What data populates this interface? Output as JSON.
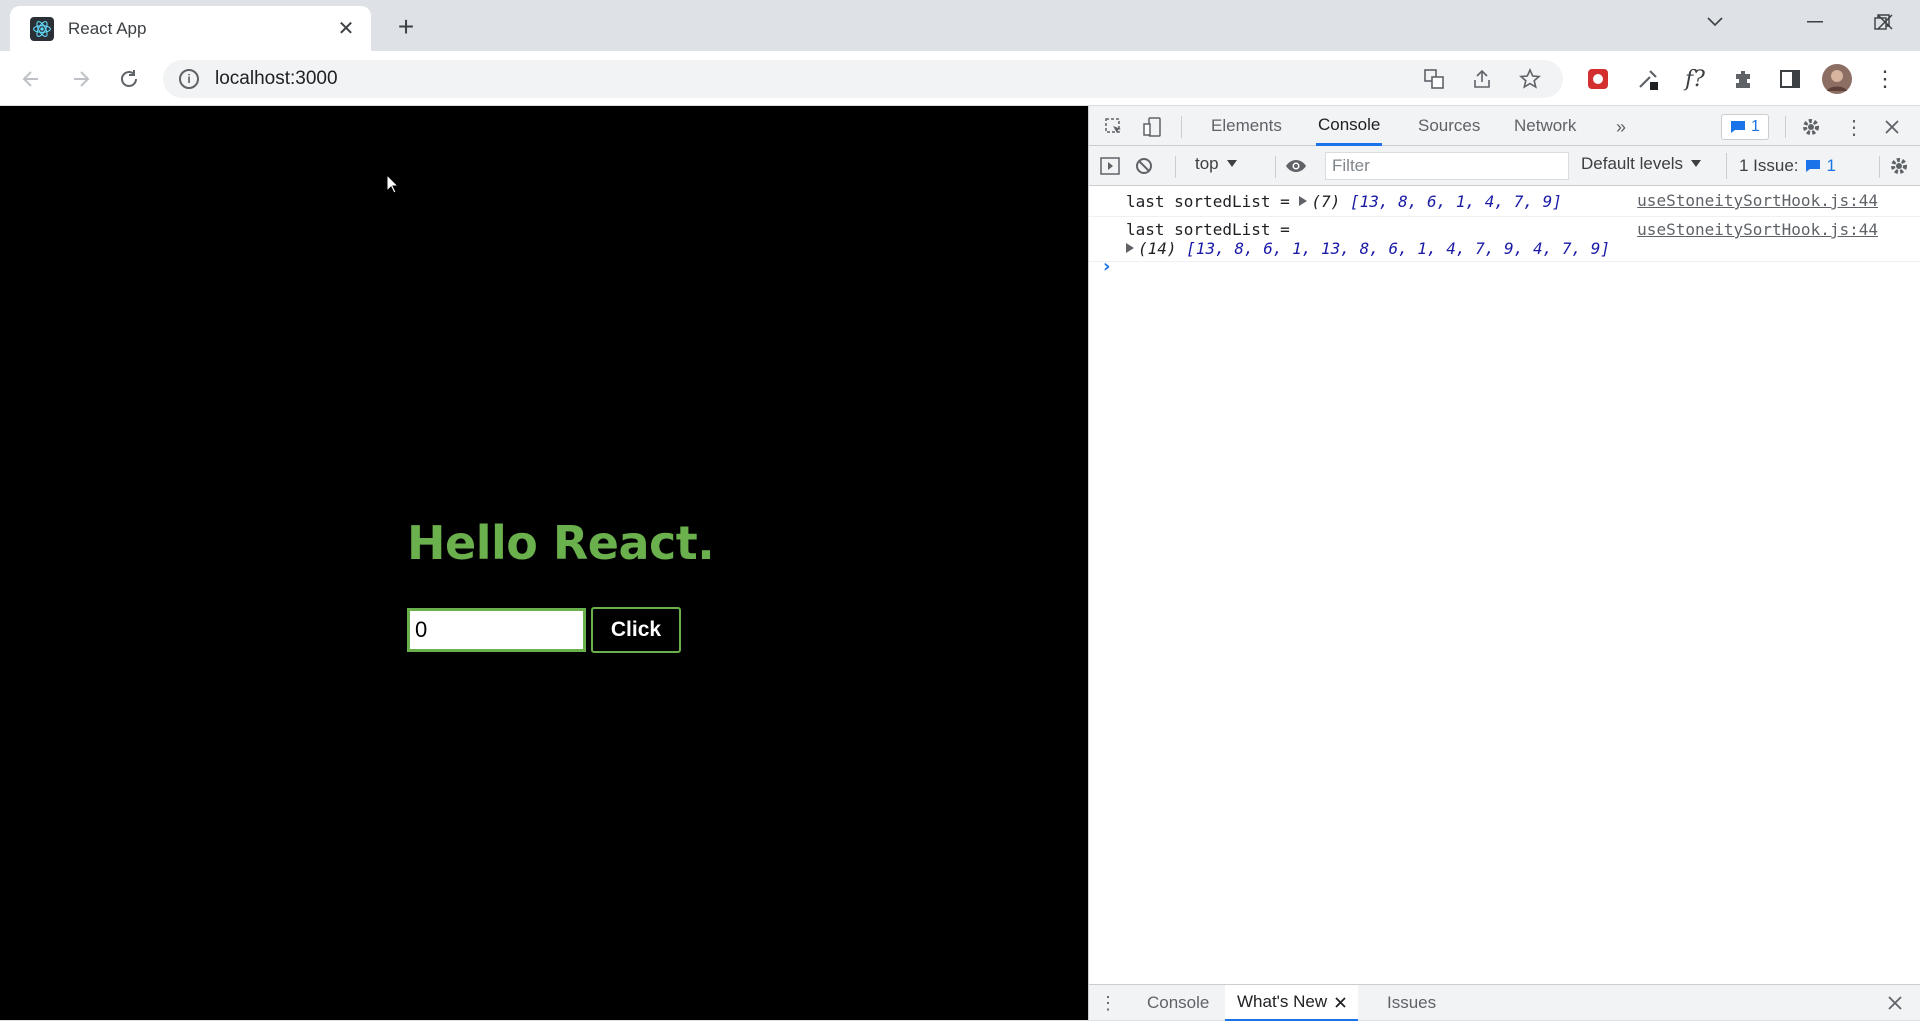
{
  "browser": {
    "tab": {
      "title": "React App",
      "favicon": "react-icon"
    },
    "new_tab_label": "+",
    "url": "localhost:3000"
  },
  "page": {
    "heading": "Hello React.",
    "input_value": "0",
    "button_label": "Click",
    "colors": {
      "background": "#000000",
      "accent": "#6ab04c"
    }
  },
  "devtools": {
    "tabs": [
      "Elements",
      "Console",
      "Sources",
      "Network"
    ],
    "active_tab": "Console",
    "message_badge": "1",
    "context": "top",
    "filter_placeholder": "Filter",
    "levels": "Default levels",
    "issues_label": "1 Issue:",
    "issues_count": "1",
    "logs": [
      {
        "text": "last sortedList = ",
        "array_len": "(7)",
        "array": "[13, 8, 6, 1, 4, 7, 9]",
        "source": "useStoneitySortHook.js:44"
      },
      {
        "text": "last sortedList = ",
        "array_len": "(14)",
        "array": "[13, 8, 6, 1, 13, 8, 6, 1, 4, 7, 9, 4, 7, 9]",
        "source": "useStoneitySortHook.js:44"
      }
    ],
    "prompt": "›",
    "drawer_tabs": [
      "Console",
      "What's New",
      "Issues"
    ],
    "drawer_active": "What's New"
  }
}
